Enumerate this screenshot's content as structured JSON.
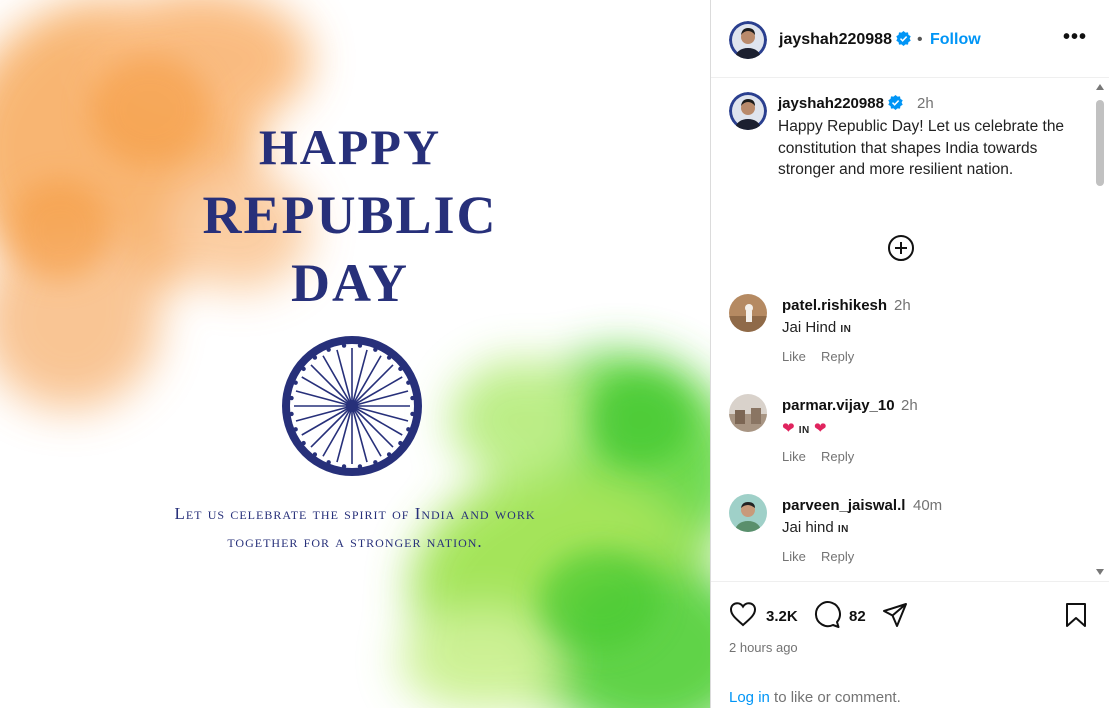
{
  "poster": {
    "line1": "HAPPY",
    "line2": "REPUBLIC",
    "line3": "DAY",
    "tagline_1": "Let us celebrate the spirit of India and work",
    "tagline_2": "together for a stronger nation.",
    "colors": {
      "saffron": "#f7a95a",
      "green": "#6fd64a",
      "navy": "#27307a"
    }
  },
  "header": {
    "username": "jayshah220988",
    "separator": "•",
    "follow_label": "Follow",
    "more_label": "•••"
  },
  "caption": {
    "username": "jayshah220988",
    "time": "2h",
    "text": "Happy Republic Day! Let us celebrate the constitution that shapes India towards stronger and more resilient nation."
  },
  "comments": [
    {
      "username": "patel.rishikesh",
      "time": "2h",
      "text": "Jai Hind",
      "flag": "IN",
      "like_label": "Like",
      "reply_label": "Reply"
    },
    {
      "username": "parmar.vijay_10",
      "time": "2h",
      "text_prefix": "❤",
      "flag": "IN",
      "text_suffix": "❤",
      "like_label": "Like",
      "reply_label": "Reply"
    },
    {
      "username": "parveen_jaiswal.l",
      "time": "40m",
      "text": "Jai hind",
      "flag": "IN",
      "like_label": "Like",
      "reply_label": "Reply"
    }
  ],
  "actions": {
    "likes": "3.2K",
    "comments": "82",
    "posted": "2 hours ago",
    "login_link": "Log in",
    "login_suffix": " to like or comment."
  },
  "icons": [
    "verified-badge-icon",
    "more-options-icon",
    "load-more-plus-icon",
    "heart-icon",
    "comment-icon",
    "share-icon",
    "bookmark-icon"
  ],
  "colors": {
    "accent": "#0095f6",
    "muted": "#737373",
    "heart_red": "#e0245e"
  }
}
